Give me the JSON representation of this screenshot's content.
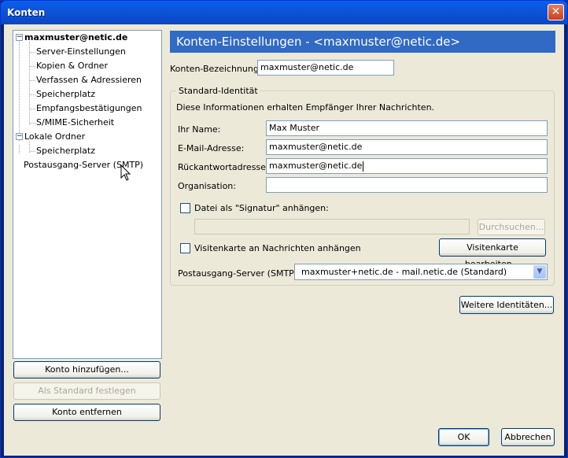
{
  "window": {
    "title": "Konten",
    "close_symbol": "✕"
  },
  "tree": {
    "account": "maxmuster@netic.de",
    "account_items": [
      "Server-Einstellungen",
      "Kopien & Ordner",
      "Verfassen & Adressieren",
      "Speicherplatz",
      "Empfangsbestätigungen",
      "S/MIME-Sicherheit"
    ],
    "local": "Lokale Ordner",
    "local_items": [
      "Speicherplatz"
    ],
    "smtp": "Postausgang-Server (SMTP)",
    "expander_symbol": "−"
  },
  "left_buttons": {
    "add": "Konto hinzufügen...",
    "default": "Als Standard festlegen",
    "remove": "Konto entfernen"
  },
  "header": {
    "title": "Konten-Einstellungen - <maxmuster@netic.de>"
  },
  "account_name": {
    "label": "Konten-Bezeichnung:",
    "value": "maxmuster@netic.de"
  },
  "identity": {
    "group_title": "Standard-Identität",
    "description": "Diese Informationen erhalten Empfänger Ihrer Nachrichten.",
    "name_label": "Ihr Name:",
    "name_value": "Max Muster",
    "email_label": "E-Mail-Adresse:",
    "email_value": "maxmuster@netic.de",
    "reply_label": "Rückantwortadresse:",
    "reply_value": "maxmuster@netic.de",
    "org_label": "Organisation:",
    "org_value": "",
    "signature_label": "Datei als \"Signatur\" anhängen:",
    "signature_path": "",
    "browse": "Durchsuchen...",
    "vcard_label": "Visitenkarte an Nachrichten anhängen",
    "vcard_edit": "Visitenkarte bearbeiten...",
    "smtp_label": "Postausgang-Server (SMTP):",
    "smtp_value": "maxmuster+netic.de - mail.netic.de (Standard)",
    "smtp_arrow": "▼"
  },
  "more_identities": "Weitere Identitäten...",
  "footer": {
    "ok": "OK",
    "cancel": "Abbrechen"
  }
}
